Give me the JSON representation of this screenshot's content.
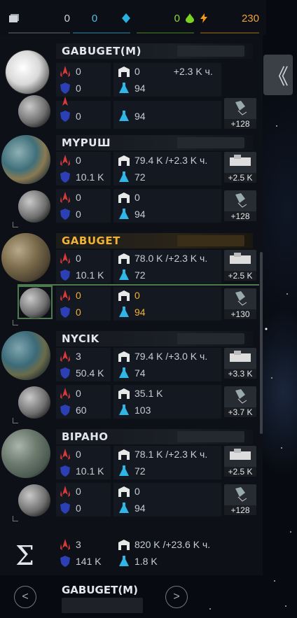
{
  "topbar": {
    "items": [
      {
        "icon": "planet-list-icon",
        "value": "0"
      },
      {
        "icon": "crystal-icon",
        "value": "0"
      },
      {
        "icon": "deuterium-icon",
        "value": "0"
      },
      {
        "icon": "energy-icon",
        "value": "230"
      }
    ]
  },
  "collapse_label": "《",
  "planets": [
    {
      "name": "GABUGET(M)",
      "attack": "0",
      "defense": "0",
      "cargo": "0",
      "rate": "+2.3 K ч.",
      "fuel": "94",
      "tile": ""
    },
    {
      "name": "",
      "attack": "0",
      "defense": "0",
      "cargo": "",
      "rate": "",
      "fuel": "94",
      "tile": "+128"
    },
    {
      "name": "MYPUШ",
      "attack": "0",
      "defense": "10.1 K",
      "cargo": "79.4 K",
      "rate": "/+2.3 K ч.",
      "fuel": "72",
      "tile": "+2.5 K"
    },
    {
      "name": "",
      "attack": "0",
      "defense": "0",
      "cargo": "0",
      "rate": "",
      "fuel": "94",
      "tile": "+128"
    },
    {
      "name": "GABUGET",
      "attack": "0",
      "defense": "10.1 K",
      "cargo": "78.0 K",
      "rate": "/+2.3 K ч.",
      "fuel": "72",
      "tile": "+2.5 K"
    },
    {
      "name": "",
      "attack": "0",
      "defense": "0",
      "cargo": "0",
      "rate": "",
      "fuel": "94",
      "tile": "+130"
    },
    {
      "name": "NYCIK",
      "attack": "3",
      "defense": "50.4 K",
      "cargo": "79.4 K",
      "rate": "/+3.0 K ч.",
      "fuel": "74",
      "tile": "+3.3 K"
    },
    {
      "name": "",
      "attack": "0",
      "defense": "60",
      "cargo": "35.1 K",
      "rate": "",
      "fuel": "103",
      "tile": "+3.7 K"
    },
    {
      "name": "BIPAHO",
      "attack": "0",
      "defense": "10.1 K",
      "cargo": "78.1 K",
      "rate": "/+2.3 K ч.",
      "fuel": "72",
      "tile": "+2.5 K"
    },
    {
      "name": "",
      "attack": "0",
      "defense": "0",
      "cargo": "0",
      "rate": "",
      "fuel": "94",
      "tile": "+128"
    }
  ],
  "summary": {
    "symbol": "Σ",
    "attack": "3",
    "defense": "141 K",
    "cargo": "820 K",
    "rate": "/+23.6 K ч.",
    "fuel": "1.8 K"
  },
  "footer": {
    "prev": "<",
    "next": ">",
    "current": "GABUGET(M)"
  },
  "colors": {
    "highlight": "#f2b233",
    "attack": "#e03a3a",
    "defense": "#3a4fc8",
    "fuel": "#2fb6e6"
  }
}
